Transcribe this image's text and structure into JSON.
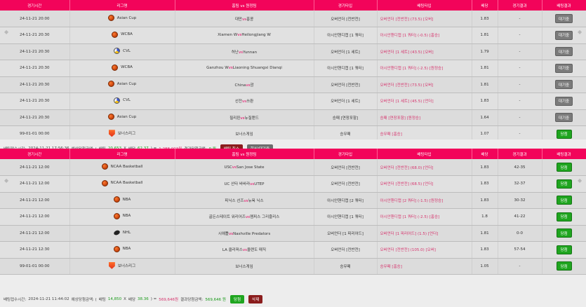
{
  "headers": [
    "경기시간",
    "리그명",
    "홈팀 vs 원정팀",
    "경기타입",
    "배팅타입",
    "배당",
    "경기결과",
    "배팅결과"
  ],
  "vs_text": "vs",
  "slip1": {
    "rows": [
      {
        "time": "24-11-21 20:00",
        "icon": "basketball-icon",
        "league": "Asian Cup",
        "home": "대만",
        "away": "홍콩",
        "type": "오버언더 [전반전]",
        "pick": "오버언더 [전반전] (73.5) [오버]",
        "odds": "1.83",
        "result": "-",
        "status": "대기중"
      },
      {
        "time": "24-11-21 20:30",
        "icon": "basketball-icon",
        "league": "WCBA",
        "home": "Xiamen W",
        "away": "Heilongjiang W",
        "type": "아시안핸디캡 [1 쿼터]",
        "pick": "아시안핸디캡 [1 쿼터] (-0.5) [홈승]",
        "odds": "1.81",
        "result": "-",
        "status": "대기중"
      },
      {
        "time": "24-11-21 20:30",
        "icon": "volleyball-icon",
        "league": "CVL",
        "home": "허난",
        "away": "Yunnan",
        "type": "오버언더 [1 세트]",
        "pick": "오버언더 [1 세트] (43.5) [오버]",
        "odds": "1.79",
        "result": "-",
        "status": "대기중"
      },
      {
        "time": "24-11-21 20:30",
        "icon": "basketball-icon",
        "league": "WCBA",
        "home": "Ganzhou W",
        "away": "Liaoning Shuangxi Dianqi",
        "type": "아시안핸디캡 [1 쿼터]",
        "pick": "아시안핸디캡 [1 쿼터] (-2.5) [원정승]",
        "odds": "1.81",
        "result": "-",
        "status": "대기중"
      },
      {
        "time": "24-11-21 20:30",
        "icon": "basketball-icon",
        "league": "Asian Cup",
        "home": "China",
        "away": "괌",
        "type": "오버언더 [전반전]",
        "pick": "오버언더 [전반전] (73.5) [오버]",
        "odds": "1.81",
        "result": "-",
        "status": "대기중"
      },
      {
        "time": "24-11-21 20:30",
        "icon": "volleyball-icon",
        "league": "CVL",
        "home": "선전",
        "away": "쓰촨",
        "type": "오버언더 [1 세트]",
        "pick": "오버언더 [1 세트] (45.5) [언더]",
        "odds": "1.83",
        "result": "-",
        "status": "대기중"
      },
      {
        "time": "24-11-21 20:30",
        "icon": "basketball-icon",
        "league": "Asian Cup",
        "home": "필리핀",
        "away": "뉴질랜드",
        "type": "승패 [연장포함]",
        "pick": "승패 [연장포함] [원정승]",
        "odds": "1.64",
        "result": "-",
        "status": "대기중"
      },
      {
        "time": "99-01-01 00:00",
        "icon": "bonus-shield-icon",
        "league": "보너스리그",
        "home": "보너스게임",
        "away": "",
        "type": "승무패",
        "pick": "승무패 [홈승]",
        "odds": "1.07",
        "result": "-",
        "status": "당첨"
      }
    ],
    "summary": {
      "time_label": "배팅접수시간:",
      "time": "2024-11-21 17:56:36",
      "expect_label": "예상당첨금액: (",
      "bet_label": "배팅",
      "bet": "20,653",
      "x": "X",
      "odds_label": "배당",
      "odds": "62.37",
      "eq": ") =",
      "expected": "1,288,003원",
      "result_label": "결과당첨금액:",
      "result": "0 원",
      "btn1": "배팅 취소",
      "btn2": "회신/대기중"
    }
  },
  "slip2": {
    "rows": [
      {
        "time": "24-11-21 12:00",
        "icon": "basketball-icon",
        "league": "NCAA Basketball",
        "home": "USC",
        "away": "San Jose State",
        "type": "오버언더 [전반전]",
        "pick": "오버언더 [전반전] (68.0) [언더]",
        "odds": "1.83",
        "result": "42-35",
        "status": "당첨"
      },
      {
        "time": "24-11-21 12:00",
        "icon": "basketball-icon",
        "league": "NCAA Basketball",
        "home": "UC 산타 바바라",
        "away": "UTEP",
        "type": "오버언더 [전반전]",
        "pick": "오버언더 [전반전] (68.5) [언더]",
        "odds": "1.83",
        "result": "32-37",
        "status": "당첨"
      },
      {
        "time": "24-11-21 12:00",
        "icon": "basketball-icon",
        "league": "NBA",
        "home": "피닉스 선즈",
        "away": "뉴욕 닉스",
        "type": "아시안핸디캡 [2 쿼터]",
        "pick": "아시안핸디캡 [2 쿼터] (-1.5) [원정승]",
        "odds": "1.83",
        "result": "30-32",
        "status": "당첨"
      },
      {
        "time": "24-11-21 12:00",
        "icon": "basketball-icon",
        "league": "NBA",
        "home": "골든스테이트 워리어즈",
        "away": "멤피스 그리즐리스",
        "type": "아시안핸디캡 [1 쿼터]",
        "pick": "아시안핸디캡 [1 쿼터] (-2.5) [홈승]",
        "odds": "1.8",
        "result": "41-22",
        "status": "당첨"
      },
      {
        "time": "24-11-21 12:00",
        "icon": "hockey-puck-icon",
        "league": "NHL",
        "home": "시애틀",
        "away": "Nashville Predators",
        "type": "오버언더 [1 피리어드]",
        "pick": "오버언더 [1 피리어드] (1.5) [언더]",
        "odds": "1.81",
        "result": "0-0",
        "status": "당첨"
      },
      {
        "time": "24-11-21 12:30",
        "icon": "basketball-icon",
        "league": "NBA",
        "home": "LA 클리퍼스",
        "away": "올랜도 매직",
        "type": "오버언더 [전반전]",
        "pick": "오버언더 [전반전] (105.0) [오버]",
        "odds": "1.83",
        "result": "57-54",
        "status": "당첨"
      },
      {
        "time": "99-01-01 00:00",
        "icon": "bonus-shield-icon",
        "league": "보너스리그",
        "home": "보너스게임",
        "away": "",
        "type": "승무패",
        "pick": "승무패 [홈승]",
        "odds": "1.05",
        "result": "-",
        "status": "당첨"
      }
    ],
    "summary": {
      "time_label": "배팅접수시간:",
      "time": "2024-11-21 11:44:02",
      "expect_label": "예상당첨금액: (",
      "bet_label": "배팅",
      "bet": "14,850",
      "x": "X",
      "odds_label": "배당",
      "odds": "38.36",
      "eq": ") =",
      "expected": "569,646원",
      "result_label": "결과당첨금액:",
      "result": "569,646 원",
      "btn1": "당첨",
      "btn2": "삭제"
    }
  },
  "colors": {
    "header": "#f2045a",
    "win": "#1fa51f",
    "wait": "#7b7b7b",
    "pick": "#d6336c"
  }
}
